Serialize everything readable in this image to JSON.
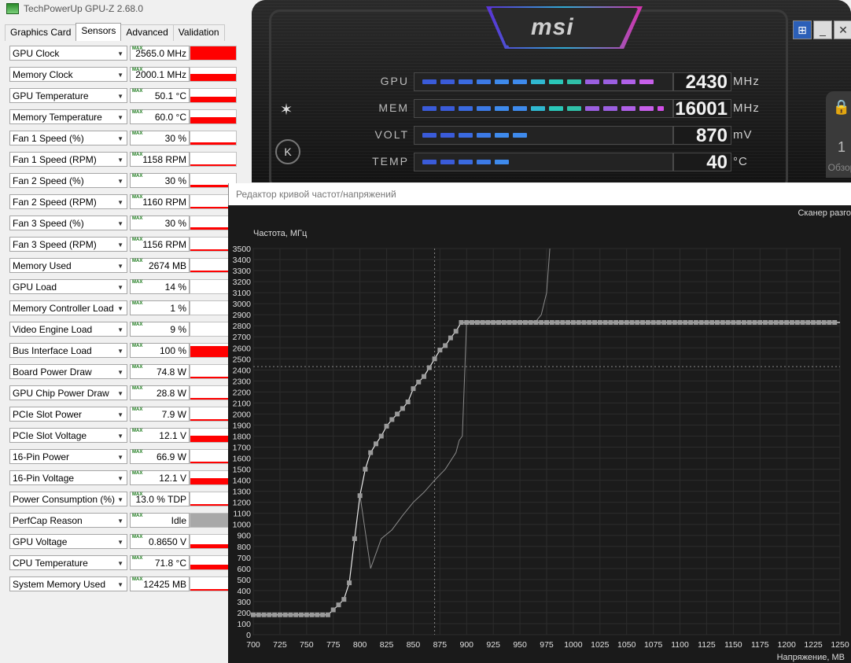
{
  "gpuz": {
    "title": "TechPowerUp GPU-Z 2.68.0",
    "tabs": [
      "Graphics Card",
      "Sensors",
      "Advanced",
      "Validation"
    ],
    "active_tab": "Sensors",
    "max_badge": "MAX",
    "sensors": [
      {
        "name": "GPU Clock",
        "value": "2565.0 MHz",
        "level": 1.0
      },
      {
        "name": "Memory Clock",
        "value": "2000.1 MHz",
        "level": 0.55
      },
      {
        "name": "GPU Temperature",
        "value": "50.1 °C",
        "level": 0.4
      },
      {
        "name": "Memory Temperature",
        "value": "60.0 °C",
        "level": 0.45
      },
      {
        "name": "Fan 1 Speed (%)",
        "value": "30 %",
        "level": 0.2
      },
      {
        "name": "Fan 1 Speed (RPM)",
        "value": "1158 RPM",
        "level": 0.05
      },
      {
        "name": "Fan 2 Speed (%)",
        "value": "30 %",
        "level": 0.2
      },
      {
        "name": "Fan 2 Speed (RPM)",
        "value": "1160 RPM",
        "level": 0.05
      },
      {
        "name": "Fan 3 Speed (%)",
        "value": "30 %",
        "level": 0.2
      },
      {
        "name": "Fan 3 Speed (RPM)",
        "value": "1156 RPM",
        "level": 0.05
      },
      {
        "name": "Memory Used",
        "value": "2674 MB",
        "level": 0.05
      },
      {
        "name": "GPU Load",
        "value": "14 %",
        "level": 0.0
      },
      {
        "name": "Memory Controller Load",
        "value": "1 %",
        "level": 0.0
      },
      {
        "name": "Video Engine Load",
        "value": "9 %",
        "level": 0.0
      },
      {
        "name": "Bus Interface Load",
        "value": "100 %",
        "level": 0.8
      },
      {
        "name": "Board Power Draw",
        "value": "74.8 W",
        "level": 0.08
      },
      {
        "name": "GPU Chip Power Draw",
        "value": "28.8 W",
        "level": 0.08
      },
      {
        "name": "PCIe Slot Power",
        "value": "7.9 W",
        "level": 0.08
      },
      {
        "name": "PCIe Slot Voltage",
        "value": "12.1 V",
        "level": 0.5
      },
      {
        "name": "16-Pin Power",
        "value": "66.9 W",
        "level": 0.08
      },
      {
        "name": "16-Pin Voltage",
        "value": "12.1 V",
        "level": 0.5
      },
      {
        "name": "Power Consumption (%)",
        "value": "13.0 % TDP",
        "level": 0.08
      },
      {
        "name": "PerfCap Reason",
        "value": "Idle",
        "level": 1.0,
        "fill_color": "#a8a8a8"
      },
      {
        "name": "GPU Voltage",
        "value": "0.8650 V",
        "level": 0.3
      },
      {
        "name": "CPU Temperature",
        "value": "71.8 °C",
        "level": 0.35
      },
      {
        "name": "System Memory Used",
        "value": "12425 MB",
        "level": 0.1
      }
    ]
  },
  "msi": {
    "brand": "msi",
    "monitors": [
      {
        "label": "GPU",
        "value": "2430",
        "unit": "MHz",
        "fill": 0.9
      },
      {
        "label": "MEM",
        "value": "16001",
        "unit": "MHz",
        "fill": 0.98
      },
      {
        "label": "VOLT",
        "value": "870",
        "unit": "mV",
        "fill": 0.42
      },
      {
        "label": "TEMP",
        "value": "40",
        "unit": "°C",
        "fill": 0.38
      }
    ],
    "side_icon_k": "K",
    "lock_value": "1",
    "behind_text": "Обзор"
  },
  "curve_editor": {
    "title": "Редактор кривой частот/напряжений",
    "scanner": "Сканер разго",
    "ylabel": "Частота, МГц",
    "xlabel": "Напряжение, МВ"
  },
  "chart_data": {
    "type": "line",
    "xlim": [
      700,
      1250
    ],
    "ylim": [
      0,
      3500
    ],
    "xticks": [
      700,
      725,
      750,
      775,
      800,
      825,
      850,
      875,
      900,
      925,
      950,
      975,
      1000,
      1025,
      1050,
      1075,
      1100,
      1125,
      1150,
      1175,
      1200,
      1225,
      1250
    ],
    "yticks": [
      0,
      100,
      200,
      300,
      400,
      500,
      600,
      700,
      800,
      900,
      1000,
      1100,
      1200,
      1300,
      1400,
      1500,
      1600,
      1700,
      1800,
      1900,
      2000,
      2100,
      2200,
      2300,
      2400,
      2500,
      2600,
      2700,
      2800,
      2900,
      3000,
      3100,
      3200,
      3300,
      3400,
      3500
    ],
    "crosshair": {
      "x": 870,
      "y": 2430
    },
    "series": [
      {
        "x": [
          700,
          705,
          710,
          715,
          720,
          725,
          730,
          735,
          740,
          745,
          750,
          755,
          760,
          765,
          770,
          775,
          780,
          785,
          790,
          795,
          800,
          805,
          810,
          815,
          820,
          825,
          830,
          835,
          840,
          845,
          850,
          855,
          860,
          865,
          870,
          875,
          880,
          885,
          890,
          895,
          900
        ],
        "y": [
          180,
          180,
          180,
          180,
          180,
          180,
          180,
          180,
          180,
          180,
          180,
          180,
          180,
          180,
          180,
          225,
          270,
          320,
          470,
          870,
          1260,
          1500,
          1650,
          1730,
          1800,
          1890,
          1950,
          2000,
          2050,
          2110,
          2230,
          2290,
          2340,
          2420,
          2500,
          2580,
          2620,
          2690,
          2750,
          2830,
          2830
        ],
        "flat_to": 1250,
        "flat_value": 2830
      },
      {
        "x": [
          800,
          810,
          820,
          830,
          840,
          850,
          860,
          870,
          880,
          890,
          893,
          896,
          900,
          925,
          950,
          965,
          970,
          975,
          978
        ],
        "y": [
          1270,
          600,
          870,
          950,
          1080,
          1200,
          1290,
          1400,
          1500,
          1650,
          1760,
          1800,
          2840,
          2840,
          2840,
          2840,
          2900,
          3100,
          3500
        ]
      }
    ]
  }
}
